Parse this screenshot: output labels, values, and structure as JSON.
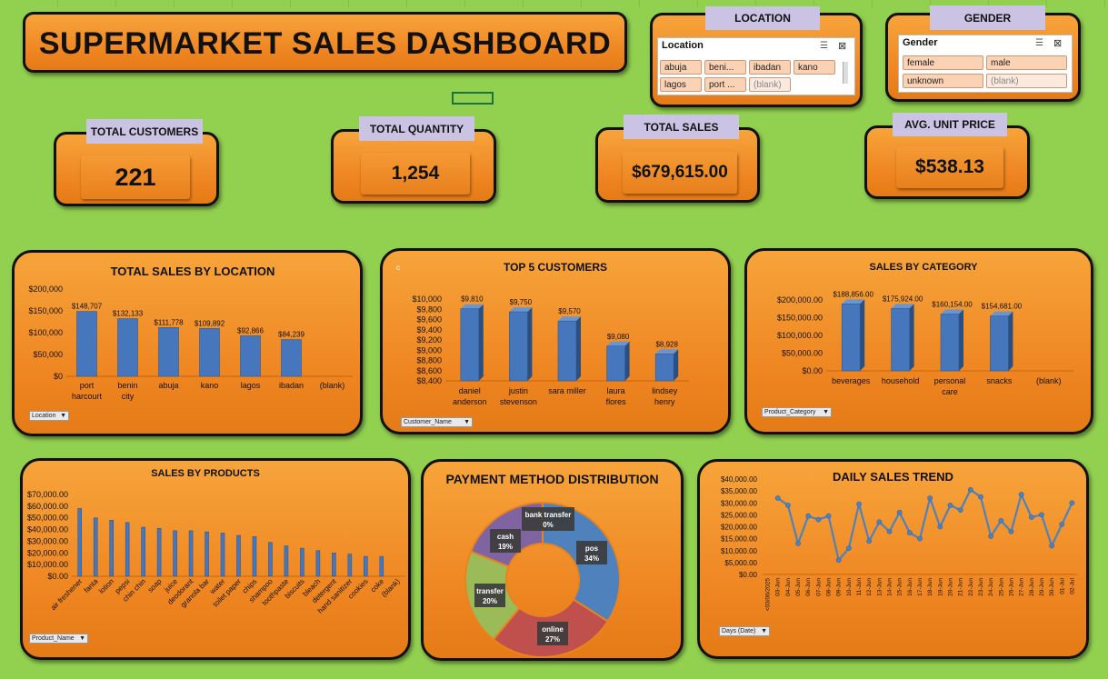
{
  "title": "SUPERMARKET SALES DASHBOARD",
  "kpis": {
    "customers": {
      "label": "TOTAL CUSTOMERS",
      "value": "221"
    },
    "quantity": {
      "label": "TOTAL QUANTITY",
      "value": "1,254"
    },
    "sales": {
      "label": "TOTAL SALES",
      "value": "$679,615.00"
    },
    "unit_price": {
      "label": "AVG. UNIT PRICE",
      "value": "$538.13"
    }
  },
  "slicers": {
    "location": {
      "tab": "LOCATION",
      "header": "Location",
      "items": [
        "abuja",
        "beni...",
        "ibadan",
        "kano",
        "lagos",
        "port ...",
        "(blank)"
      ]
    },
    "gender": {
      "tab": "GENDER",
      "header": "Gender",
      "items": [
        "female",
        "male",
        "unknown",
        "(blank)"
      ]
    }
  },
  "filters": {
    "location": "Location",
    "customer": "Customer_Name",
    "category": "Product_Category",
    "product": "Product_Name",
    "days": "Days (Date)"
  },
  "stray_label": "c",
  "chart_data": [
    {
      "id": "location",
      "type": "bar",
      "title": "TOTAL SALES BY LOCATION",
      "categories": [
        "port harcourt",
        "benin city",
        "abuja",
        "kano",
        "lagos",
        "ibadan",
        "(blank)"
      ],
      "values": [
        148707,
        132133,
        111778,
        109892,
        92866,
        84239,
        null
      ],
      "data_labels": [
        "$148,707",
        "$132,133",
        "$111,778",
        "$109,892",
        "$92,866",
        "$84,239",
        ""
      ],
      "yticks": [
        "$0",
        "$50,000",
        "$100,000",
        "$150,000",
        "$200,000"
      ],
      "ylim": [
        0,
        200000
      ]
    },
    {
      "id": "customers",
      "type": "bar",
      "title": "TOP 5 CUSTOMERS",
      "categories": [
        "daniel anderson",
        "justin stevenson",
        "sara miller",
        "laura flores",
        "lindsey henry"
      ],
      "values": [
        9810,
        9750,
        9570,
        9080,
        8928
      ],
      "data_labels": [
        "$9,810",
        "$9,750",
        "$9,570",
        "$9,080",
        "$8,928"
      ],
      "yticks": [
        "$8,400",
        "$8,600",
        "$8,800",
        "$9,000",
        "$9,200",
        "$9,400",
        "$9,600",
        "$9,800",
        "$10,000"
      ],
      "ylim": [
        8400,
        10000
      ]
    },
    {
      "id": "category",
      "type": "bar",
      "title": "SALES BY CATEGORY",
      "categories": [
        "beverages",
        "household",
        "personal care",
        "snacks",
        "(blank)"
      ],
      "values": [
        188856,
        175924,
        160154,
        154681,
        null
      ],
      "data_labels": [
        "$188,856.00",
        "$175,924.00",
        "$160,154.00",
        "$154,681.00",
        ""
      ],
      "yticks": [
        "$0.00",
        "$50,000.00",
        "$100,000.00",
        "$150,000.00",
        "$200,000.00"
      ],
      "ylim": [
        0,
        200000
      ]
    },
    {
      "id": "products",
      "type": "bar",
      "title": "SALES BY PRODUCTS",
      "categories": [
        "air freshener",
        "fanta",
        "lotion",
        "pepsi",
        "chin chin",
        "soap",
        "juice",
        "deodorant",
        "granola bar",
        "water",
        "toilet paper",
        "chips",
        "shampoo",
        "toothpaste",
        "biscuits",
        "bleach",
        "detergent",
        "hand sanitizer",
        "cookies",
        "coke",
        "(blank)"
      ],
      "values": [
        58000,
        50000,
        48000,
        46000,
        42000,
        41000,
        39000,
        39000,
        38000,
        37000,
        35000,
        34000,
        29000,
        26000,
        24000,
        22000,
        20000,
        19000,
        17000,
        17000,
        null
      ],
      "yticks": [
        "$0.00",
        "$10,000.00",
        "$20,000.00",
        "$30,000.00",
        "$40,000.00",
        "$50,000.00",
        "$60,000.00",
        "$70,000.00"
      ],
      "ylim": [
        0,
        70000
      ]
    },
    {
      "id": "payment",
      "type": "pie",
      "title": "PAYMENT METHOD DISTRIBUTION",
      "labels": [
        "pos",
        "online",
        "transfer",
        "cash",
        "bank transfer"
      ],
      "values": [
        34,
        27,
        20,
        19,
        0
      ],
      "percent_labels": [
        "34%",
        "27%",
        "20%",
        "19%",
        "0%"
      ],
      "colors": [
        "#4f81bd",
        "#c0504d",
        "#9bbb59",
        "#8064a2",
        "#4bacc6"
      ]
    },
    {
      "id": "daily",
      "type": "line",
      "title": "DAILY SALES TREND",
      "x": [
        "<03/06/2025",
        "03-Jun",
        "04-Jun",
        "05-Jun",
        "06-Jun",
        "07-Jun",
        "08-Jun",
        "09-Jun",
        "10-Jun",
        "11-Jun",
        "12-Jun",
        "13-Jun",
        "14-Jun",
        "15-Jun",
        "16-Jun",
        "17-Jun",
        "18-Jun",
        "19-Jun",
        "20-Jun",
        "21-Jun",
        "22-Jun",
        "23-Jun",
        "24-Jun",
        "25-Jun",
        "26-Jun",
        "27-Jun",
        "28-Jun",
        "29-Jun",
        "30-Jun",
        "01-Jul",
        "02-Jul"
      ],
      "y": [
        null,
        32000,
        29000,
        13000,
        24500,
        23000,
        24500,
        6000,
        11000,
        29500,
        14000,
        22000,
        18000,
        26000,
        17500,
        15000,
        32000,
        20000,
        29000,
        27000,
        35500,
        32500,
        16000,
        22500,
        18000,
        33500,
        24000,
        25000,
        12000,
        21000,
        30000
      ],
      "yticks": [
        "$0.00",
        "$5,000.00",
        "$10,000.00",
        "$15,000.00",
        "$20,000.00",
        "$25,000.00",
        "$30,000.00",
        "$35,000.00",
        "$40,000.00"
      ],
      "ylim": [
        0,
        40000
      ]
    }
  ]
}
